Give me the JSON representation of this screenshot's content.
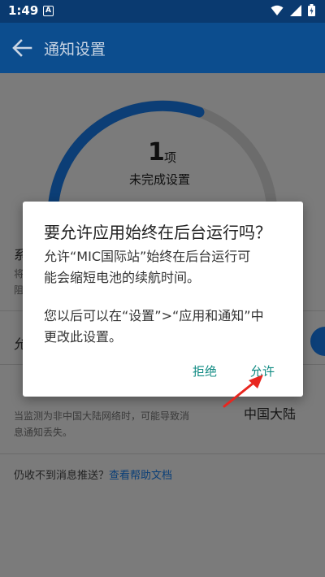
{
  "status_bar": {
    "time": "1:49",
    "sim_label": "A"
  },
  "app_bar": {
    "title": "通知设置"
  },
  "summary": {
    "count": "1",
    "unit": "项",
    "caption": "未完成设置",
    "progress": 0.6
  },
  "rows": {
    "row1_label_partial": "系",
    "row1_sub_partial": [
      "将",
      "阻"
    ],
    "row2_label_partial": "允"
  },
  "network": {
    "label_partial": "网络情况",
    "description": [
      "当监测为非中国大陆网络时，可能导致消",
      "息通知丢失。"
    ],
    "value": "中国大陆"
  },
  "help": {
    "prefix": "仍收不到消息推送？",
    "link": "查看帮助文档"
  },
  "dialog": {
    "title": "要允许应用始终在后台运行吗？",
    "message1_lines": [
      "允许“MIC国际站”始终在后台运行可",
      "能会缩短电池的续航时间。"
    ],
    "message2_lines": [
      "您以后可以在“设置”>“应用和通知”中",
      "更改此设置。"
    ],
    "deny_label": "拒绝",
    "allow_label": "允许"
  },
  "colors": {
    "app_bar": "#0c4d8e",
    "status_bar": "#0a3a70",
    "accent_teal": "#0f8a82",
    "annotation_arrow": "#e8261f"
  }
}
